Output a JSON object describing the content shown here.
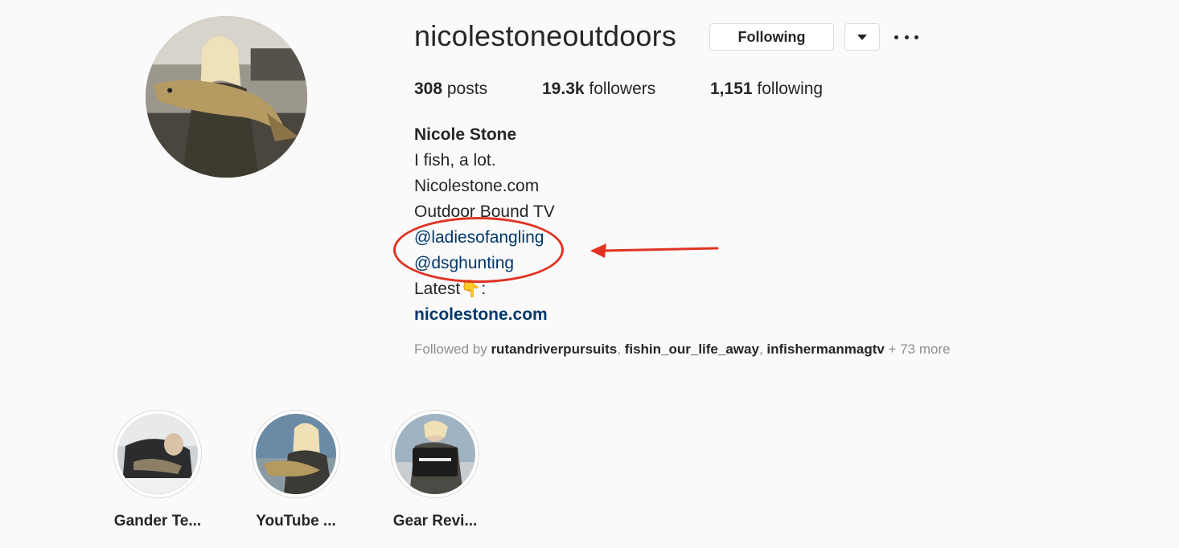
{
  "profile": {
    "username": "nicolestoneoutdoors",
    "following_button": "Following",
    "dropdown_icon": "caret-down-icon",
    "more_icon": "more-horizontal-icon"
  },
  "stats": {
    "posts_count": "308",
    "posts_label": " posts",
    "followers_count": "19.3k",
    "followers_label": " followers",
    "following_count": "1,151",
    "following_label": " following"
  },
  "bio": {
    "name": "Nicole Stone",
    "line1": "I fish, a lot.",
    "line2": "Nicolestone.com",
    "line3": "Outdoor Bound TV",
    "mention1": "@ladiesofangling",
    "mention2": "@dsghunting",
    "latest_text": "Latest",
    "latest_emoji": "👇",
    "latest_suffix": ":",
    "website": "nicolestone.com"
  },
  "followed_by": {
    "prefix": "Followed by ",
    "users": [
      "rutandriverpursuits",
      "fishin_our_life_away",
      "infishermanmagtv"
    ],
    "sep1": ", ",
    "sep2": ", ",
    "more": " + 73 more"
  },
  "annotation": {
    "color": "#e03323"
  },
  "highlights": [
    {
      "label": "Gander Te..."
    },
    {
      "label": "YouTube ..."
    },
    {
      "label": "Gear Revi..."
    }
  ],
  "colors": {
    "link": "#00376b",
    "muted": "#8e8e8e",
    "text": "#262626",
    "background": "#fafafa"
  }
}
